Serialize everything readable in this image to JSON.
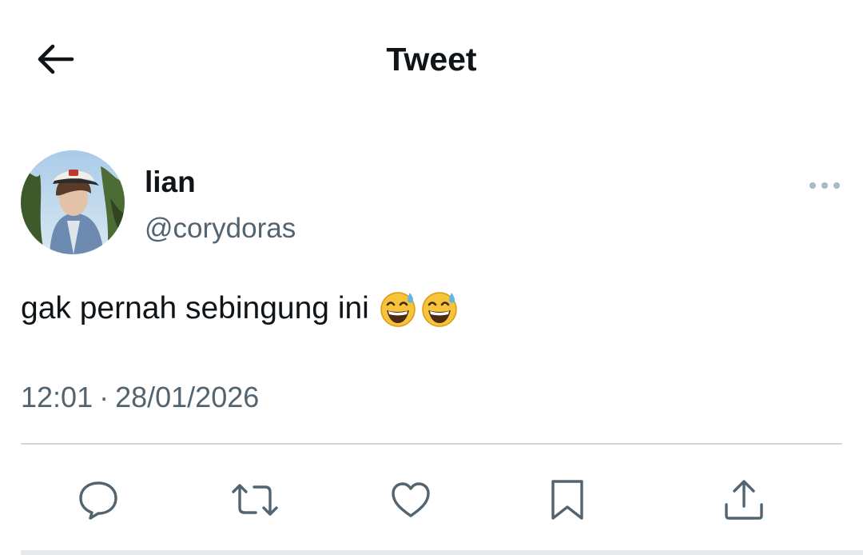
{
  "header": {
    "title": "Tweet",
    "back_icon": "arrow-left-icon"
  },
  "tweet": {
    "author": {
      "display_name": "lian",
      "handle": "@corydoras",
      "avatar": "profile-photo"
    },
    "text": "gak pernah sebingung ini",
    "emojis": [
      "grinning-face-with-sweat-emoji",
      "grinning-face-with-sweat-emoji"
    ],
    "time": "12:01",
    "separator": "·",
    "date": "28/01/2026"
  },
  "actions": [
    {
      "icon": "reply-icon"
    },
    {
      "icon": "retweet-icon"
    },
    {
      "icon": "like-icon"
    },
    {
      "icon": "bookmark-icon"
    },
    {
      "icon": "share-icon"
    }
  ],
  "colors": {
    "text_primary": "#0f1419",
    "text_secondary": "#536471",
    "divider": "#cfd9de"
  }
}
